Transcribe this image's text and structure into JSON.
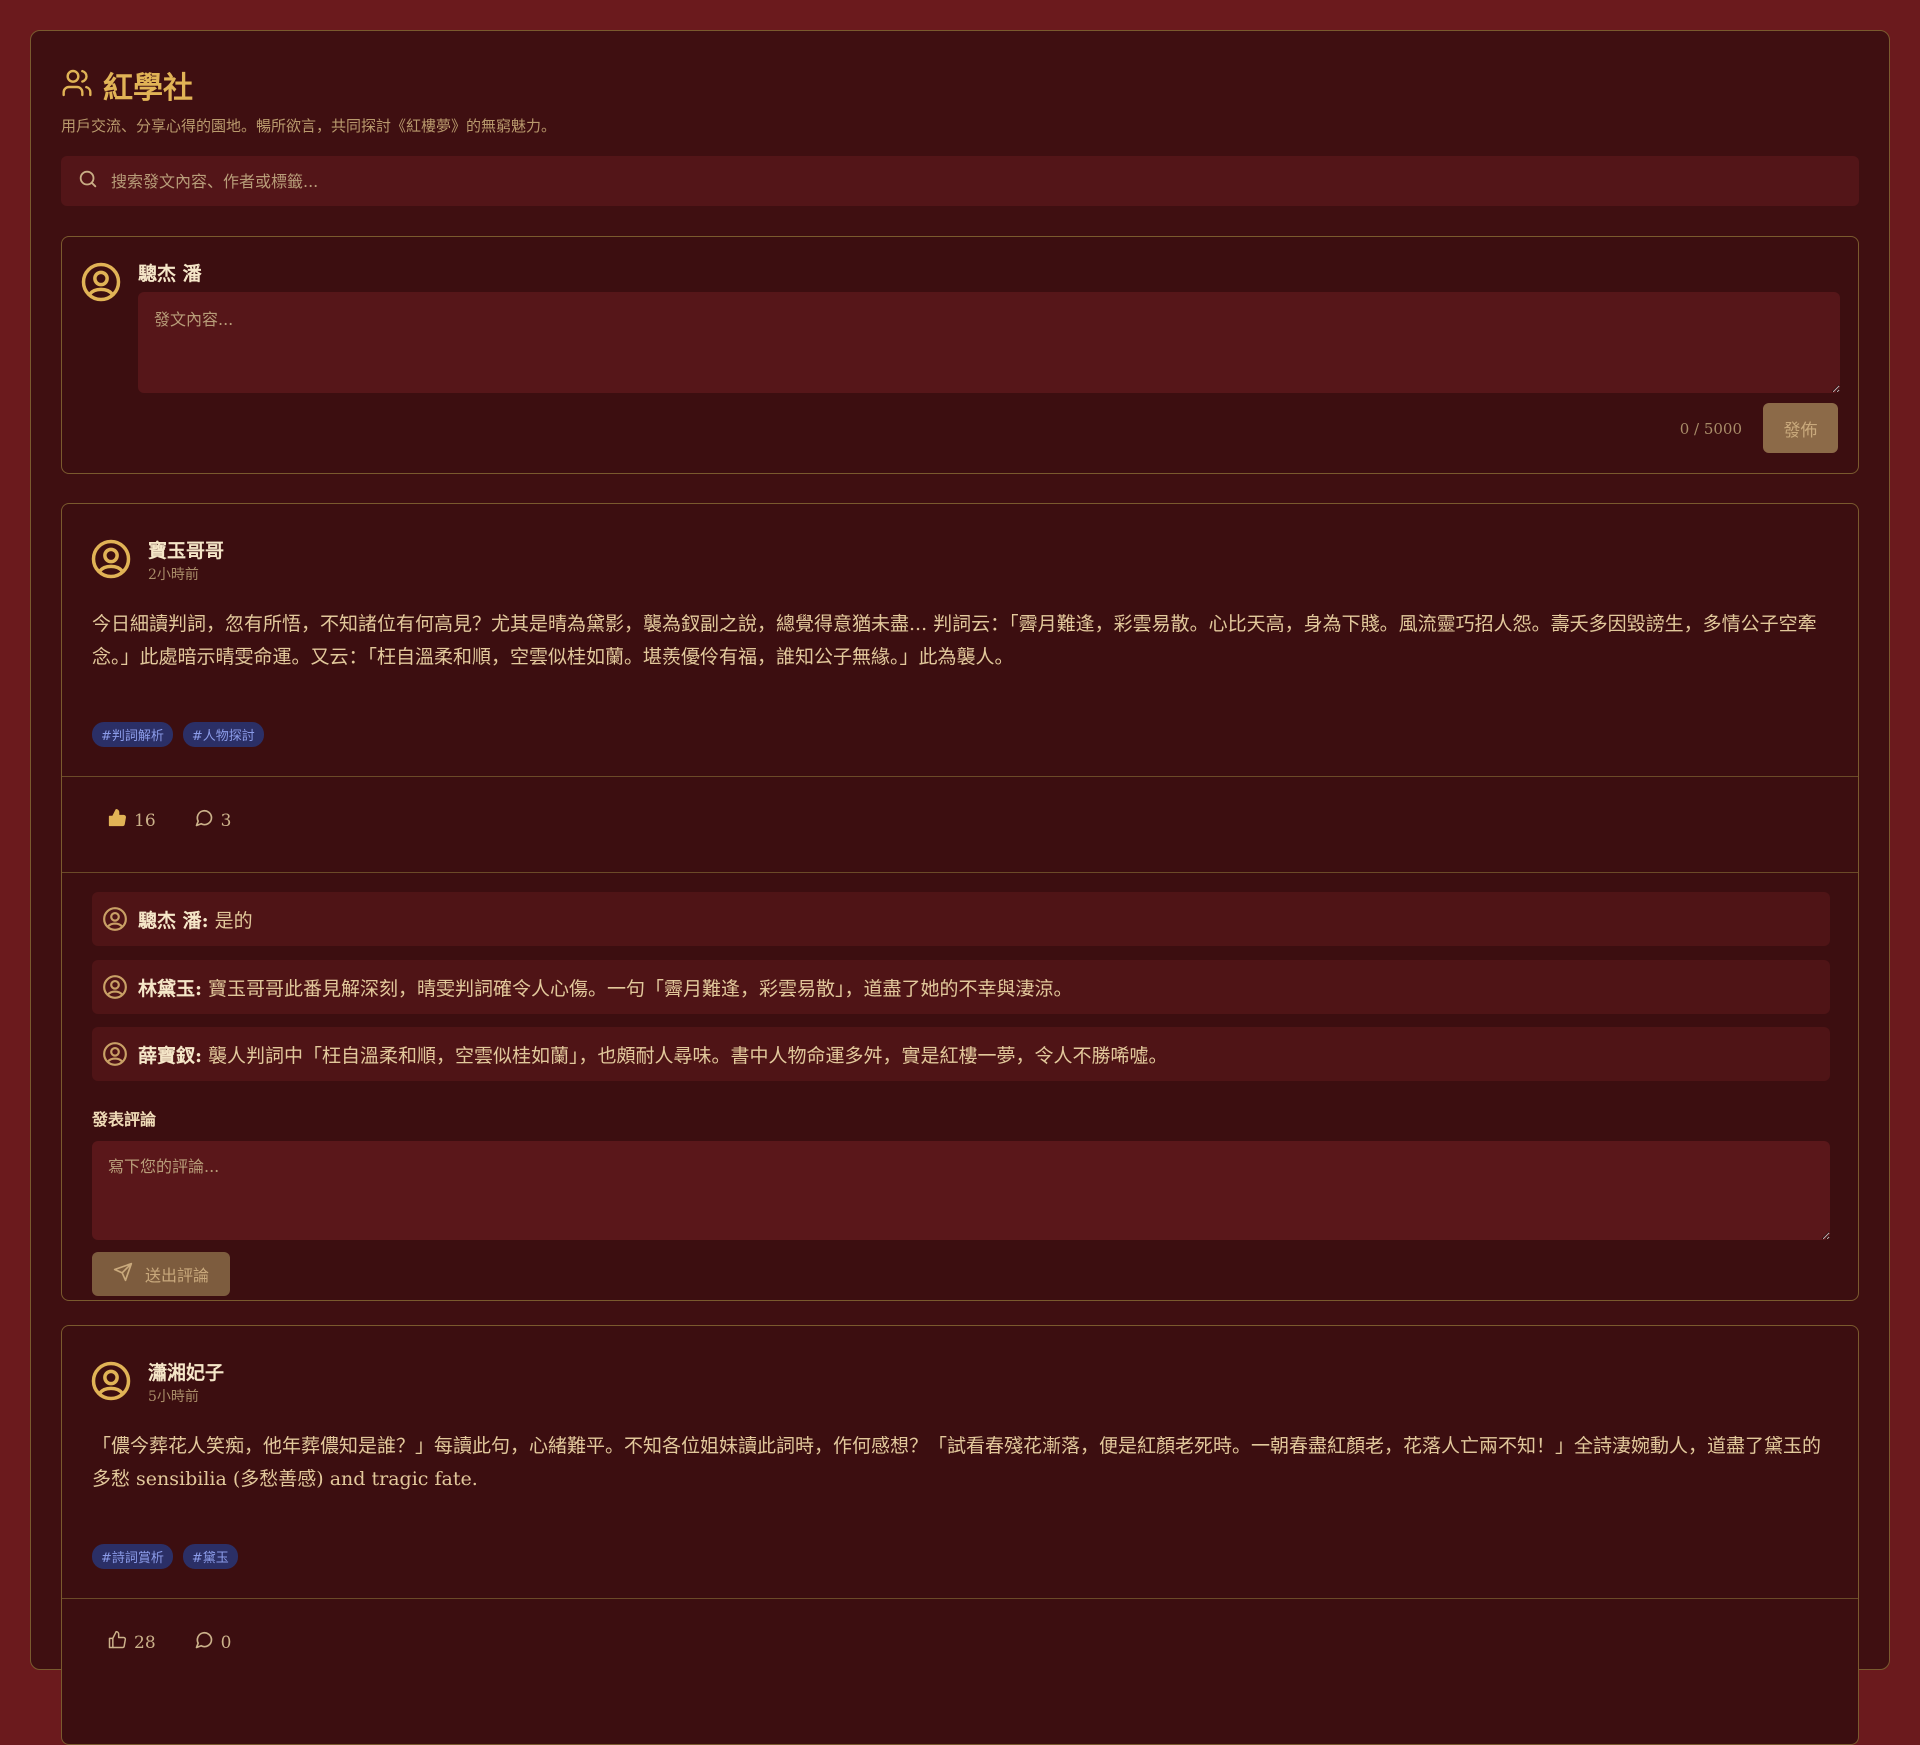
{
  "header": {
    "title": "紅學社",
    "subtitle": "用戶交流、分享心得的園地。暢所欲言，共同探討《紅樓夢》的無窮魅力。"
  },
  "search": {
    "placeholder": "搜索發文內容、作者或標籤..."
  },
  "composer": {
    "user_name": "驄杰 潘",
    "placeholder": "發文內容...",
    "counter": "0 / 5000",
    "post_label": "發佈"
  },
  "posts": [
    {
      "author": "寶玉哥哥",
      "time": "2小時前",
      "body": "今日細讀判詞，忽有所悟，不知諸位有何高見？尤其是晴為黛影，襲為釵副之說，總覺得意猶未盡... 判詞云：「霽月難逢，彩雲易散。心比天高，身為下賤。風流靈巧招人怨。壽夭多因毀謗生，多情公子空牽念。」此處暗示晴雯命運。又云：「枉自溫柔和順，空雲似桂如蘭。堪羨優伶有福，誰知公子無緣。」此為襲人。",
      "tags": [
        "#判詞解析",
        "#人物探討"
      ],
      "likes": "16",
      "comments_count": "3",
      "comments": [
        {
          "author": "驄杰 潘:",
          "text": "是的"
        },
        {
          "author": "林黛玉:",
          "text": "寶玉哥哥此番見解深刻，晴雯判詞確令人心傷。一句「霽月難逢，彩雲易散」，道盡了她的不幸與淒涼。"
        },
        {
          "author": "薛寶釵:",
          "text": "襲人判詞中「枉自溫柔和順，空雲似桂如蘭」，也頗耐人尋味。書中人物命運多舛，實是紅樓一夢，令人不勝唏噓。"
        }
      ],
      "comment_section_label": "發表評論",
      "comment_placeholder": "寫下您的評論...",
      "send_label": "送出評論"
    },
    {
      "author": "瀟湘妃子",
      "time": "5小時前",
      "body": "「儂今葬花人笑痴，他年葬儂知是誰？」每讀此句，心緒難平。不知各位姐妹讀此詞時，作何感想？「試看春殘花漸落，便是紅顏老死時。一朝春盡紅顏老，花落人亡兩不知！」全詩淒婉動人，道盡了黛玉的多愁 sensibilia (多愁善感) and tragic fate.",
      "tags": [
        "#詩詞賞析",
        "#黛玉"
      ],
      "likes": "28",
      "comments_count": "0"
    }
  ],
  "colors": {
    "page_bg": "#6b1a1d",
    "panel_bg": "#3f0f11",
    "accent": "#e1b356",
    "tag_bg": "#2b2f66",
    "tag_text": "#8b9be8"
  },
  "icons": [
    "users-icon",
    "search-icon",
    "user-avatar-icon",
    "thumbs-up-icon",
    "comment-icon",
    "send-icon"
  ]
}
